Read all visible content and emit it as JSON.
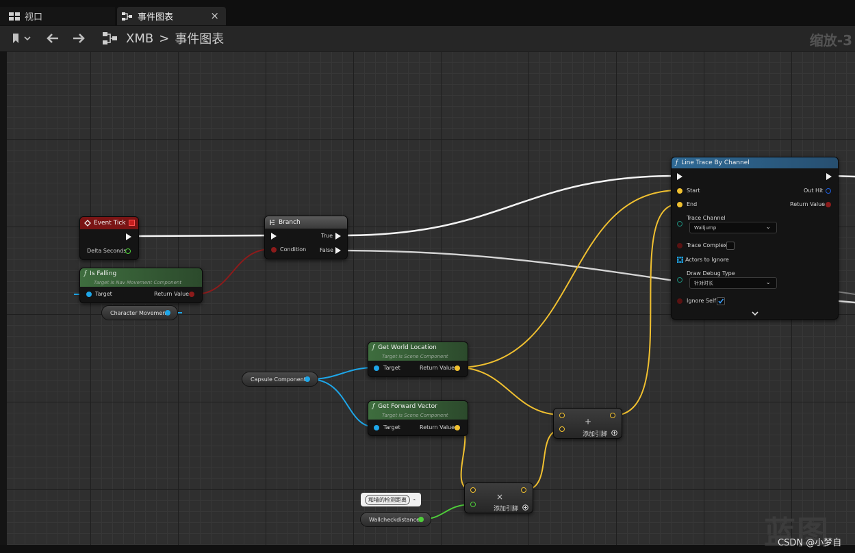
{
  "tabs": {
    "viewport": "视口",
    "graph": "事件图表",
    "close": "×"
  },
  "toolbar": {
    "breadcrumb_root": "XMB",
    "breadcrumb_sep": ">",
    "breadcrumb_page": "事件图表",
    "zoom": "缩放-3"
  },
  "nodes": {
    "event_tick": {
      "title": "Event Tick",
      "out": "Delta Seconds"
    },
    "is_falling": {
      "title": "Is Falling",
      "subtitle": "Target is Nav Movement Component",
      "target": "Target",
      "ret": "Return Value"
    },
    "char_move": {
      "label": "Character Movement"
    },
    "branch": {
      "title": "Branch",
      "cond": "Condition",
      "true": "True",
      "false": "False"
    },
    "line_trace": {
      "title": "Line Trace By Channel",
      "start": "Start",
      "end": "End",
      "out_hit": "Out Hit",
      "ret": "Return Value",
      "trace_channel": "Trace Channel",
      "trace_channel_val": "Walljump",
      "trace_complex": "Trace Complex",
      "actors_ignore": "Actors to Ignore",
      "draw_debug": "Draw Debug Type",
      "draw_debug_val": "针对时长",
      "ignore_self": "Ignore Self"
    },
    "capsule": {
      "label": "Capsule Component"
    },
    "get_world_loc": {
      "title": "Get World Location",
      "subtitle": "Target is Scene Component",
      "target": "Target",
      "ret": "Return Value"
    },
    "get_fwd": {
      "title": "Get Forward Vector",
      "subtitle": "Target is Scene Component",
      "target": "Target",
      "ret": "Return Value"
    },
    "add": {
      "symbol": "+",
      "label": "添加引脚"
    },
    "mul": {
      "symbol": "×",
      "label": "添加引脚"
    },
    "wallcheck": {
      "label": "Wallcheckdistance",
      "comment": "和墙的检测距离"
    }
  },
  "watermark": "蓝图",
  "credit": "CSDN @小梦自",
  "colors": {
    "exec": "#f2f2f2",
    "bool": "#8c1b1b",
    "vector": "#f0c030",
    "object": "#1ea6e8",
    "float": "#4fce3a",
    "event_header": "#7a1414",
    "func_header": "#3b6b3b",
    "trace_header": "#2b5f8a"
  }
}
